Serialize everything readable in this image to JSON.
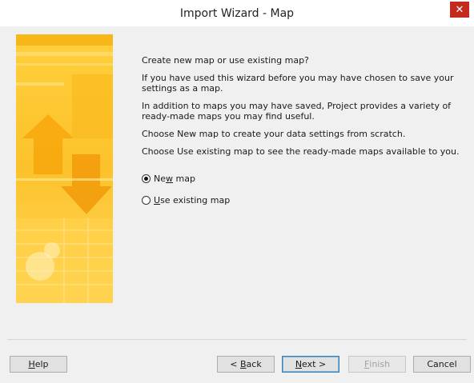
{
  "window": {
    "title": "Import Wizard - Map",
    "close_glyph": "✕"
  },
  "content": {
    "heading": "Create new map or use existing map?",
    "para1": "If you have used this wizard before you may have chosen to save your settings as a map.",
    "para2": "In addition to maps you may have saved, Project provides a variety of ready-made maps you may find useful.",
    "para3": "Choose New map to create your data settings from scratch.",
    "para4": "Choose Use existing map to see the ready-made maps available to you."
  },
  "options": {
    "new_map": {
      "pre": "Ne",
      "accel": "w",
      "post": " map",
      "checked": true
    },
    "existing_map": {
      "pre": "",
      "accel": "U",
      "post": "se existing map",
      "checked": false
    }
  },
  "buttons": {
    "help": {
      "pre": "",
      "accel": "H",
      "post": "elp"
    },
    "back": {
      "pre": "< ",
      "accel": "B",
      "post": "ack"
    },
    "next": {
      "pre": "",
      "accel": "N",
      "post": "ext >"
    },
    "finish": {
      "pre": "",
      "accel": "F",
      "post": "inish"
    },
    "cancel": {
      "label": "Cancel"
    }
  },
  "colors": {
    "banner_light": "#ffd54a",
    "banner_mid": "#f7b718",
    "banner_dark": "#e88f0a",
    "close_red": "#c42b1c"
  }
}
